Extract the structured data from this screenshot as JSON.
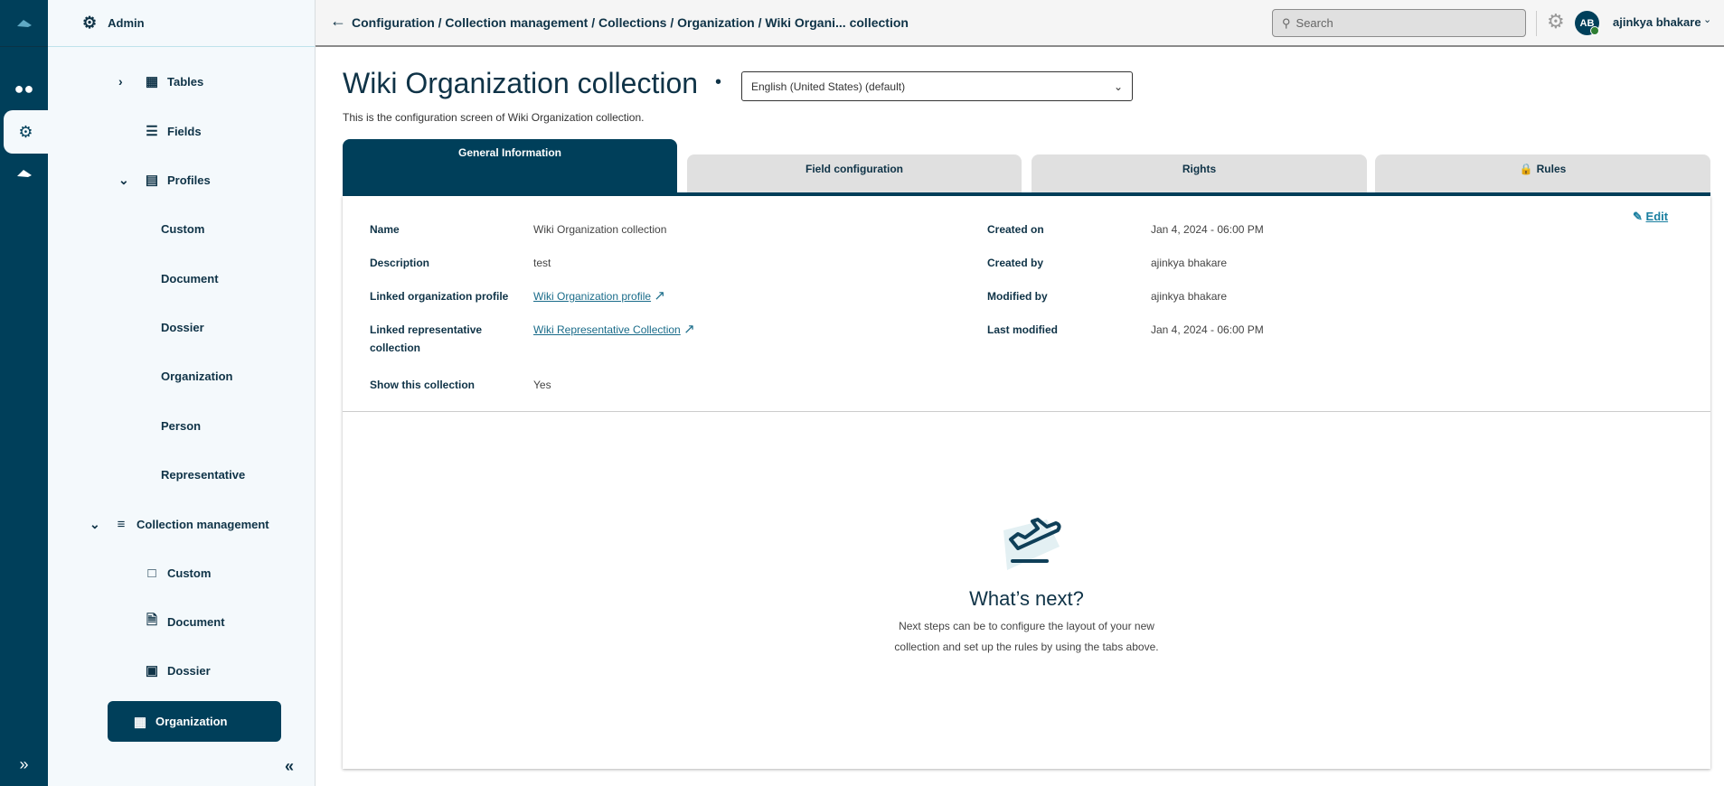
{
  "rail": {
    "items": [
      "logo-icon",
      "users-icon",
      "gear-icon",
      "cloud-icon"
    ],
    "expand": "»"
  },
  "sidebar": {
    "header": "Admin",
    "items": [
      {
        "label": "Tables",
        "icon": "table-icon"
      },
      {
        "label": "Fields",
        "icon": "fields-icon"
      },
      {
        "label": "Profiles",
        "icon": "profiles-icon"
      },
      {
        "label": "Custom"
      },
      {
        "label": "Document"
      },
      {
        "label": "Dossier"
      },
      {
        "label": "Organization"
      },
      {
        "label": "Person"
      },
      {
        "label": "Representative"
      },
      {
        "label": "Collection management",
        "icon": "layers-icon"
      },
      {
        "label": "Custom",
        "icon": "custom-icon"
      },
      {
        "label": "Document",
        "icon": "document-icon"
      },
      {
        "label": "Dossier",
        "icon": "briefcase-icon"
      },
      {
        "label": "Organization",
        "icon": "building-icon"
      }
    ],
    "collapse": "«"
  },
  "header": {
    "breadcrumb": "Configuration / Collection management / Collections / Organization / Wiki Organi... collection",
    "search_placeholder": "Search",
    "avatar": "AB",
    "user": "ajinkya bhakare"
  },
  "page": {
    "title": "Wiki Organization collection",
    "language": "English (United States) (default)",
    "subtitle": "This is the configuration screen of Wiki Organization collection.",
    "tabs": [
      "General Information",
      "Field configuration",
      "Rights",
      "Rules"
    ]
  },
  "info": {
    "edit": "Edit",
    "left": [
      {
        "label": "Name",
        "value": "Wiki Organization collection"
      },
      {
        "label": "Description",
        "value": "test"
      },
      {
        "label": "Linked organization profile",
        "value": "Wiki Organization profile"
      },
      {
        "label": "Linked representative collection",
        "value": "Wiki Representative Collection"
      },
      {
        "label": "Show this collection",
        "value": "Yes"
      }
    ],
    "right": [
      {
        "label": "Created on",
        "value": "Jan 4, 2024 - 06:00 PM"
      },
      {
        "label": "Created by",
        "value": "ajinkya bhakare"
      },
      {
        "label": "Modified by",
        "value": "ajinkya bhakare"
      },
      {
        "label": "Last modified",
        "value": "Jan 4, 2024 - 06:00 PM"
      }
    ]
  },
  "empty": {
    "title": "What’s next?",
    "line1": "Next steps can be to configure the layout of your new",
    "line2": "collection and set up the rules by using the tabs above."
  },
  "colors": {
    "primary": "#003f5a",
    "link": "#1a6c8a"
  }
}
